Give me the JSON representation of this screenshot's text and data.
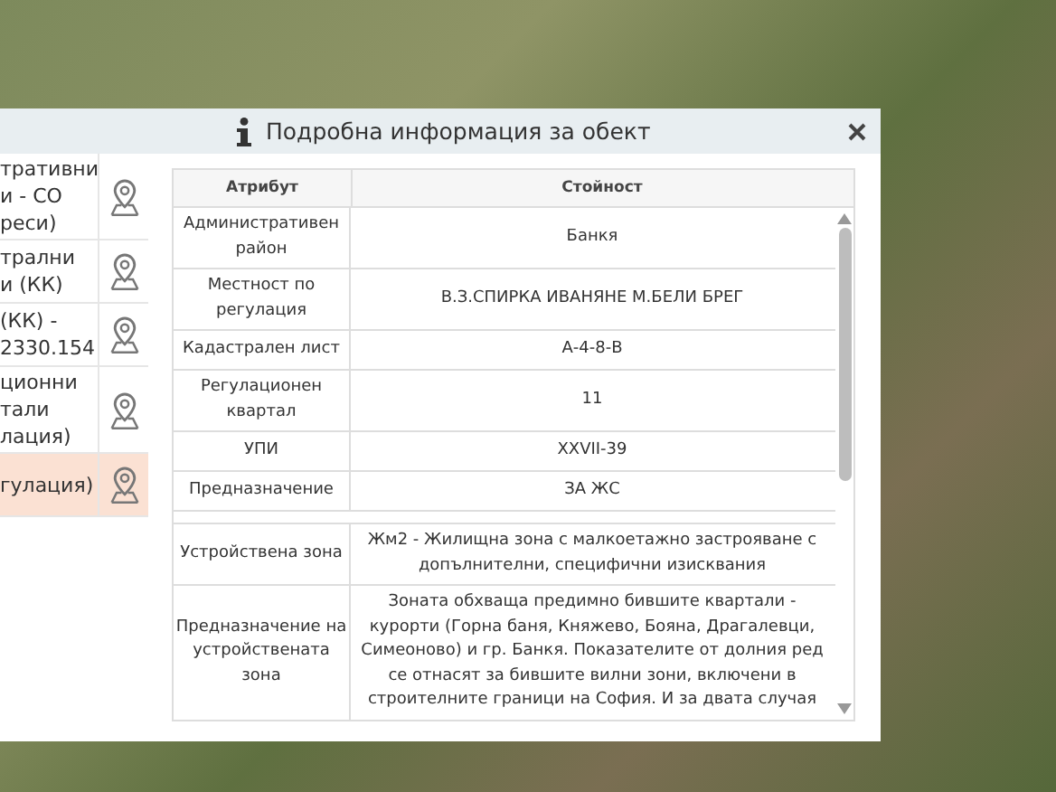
{
  "dialog": {
    "title": "Подробна информация за обект"
  },
  "layers": [
    {
      "lines": [
        "тративни",
        "и - СО",
        "реси)"
      ],
      "selected": false
    },
    {
      "lines": [
        "трални",
        "и (КК)"
      ],
      "selected": false
    },
    {
      "lines": [
        "(КК) -",
        "2330.154"
      ],
      "selected": false
    },
    {
      "lines": [
        "ционни",
        "тали",
        "лация)"
      ],
      "selected": false
    },
    {
      "lines": [
        "гулация)"
      ],
      "selected": true
    }
  ],
  "table": {
    "columns": [
      "Атрибут",
      "Стойност"
    ],
    "rows": [
      {
        "kind": "data",
        "attribute": "Административен район",
        "value": "Банкя"
      },
      {
        "kind": "data",
        "attribute": "Местност по регулация",
        "value": "В.З.СПИРКА ИВАНЯНЕ М.БЕЛИ БРЕГ"
      },
      {
        "kind": "data",
        "attribute": "Кадастрален лист",
        "value": "А-4-8-В"
      },
      {
        "kind": "data",
        "attribute": "Регулационен квартал",
        "value": "11"
      },
      {
        "kind": "data",
        "attribute": "УПИ",
        "value": "XXVII-39"
      },
      {
        "kind": "data",
        "attribute": "Предназначение",
        "value": "ЗА ЖС"
      },
      {
        "kind": "spacer"
      },
      {
        "kind": "data",
        "attribute": "Устройствена зона",
        "value": "Жм2 - Жилищна зона с малкоетажно застрояване с допълнителни, специфични изисквания"
      },
      {
        "kind": "data",
        "attribute": "Предназначение на устройствената зона",
        "value": "Зоната обхваща предимно бившите квартали - курорти (Горна баня, Княжево, Бояна, Драгалевци, Симеоново) и гр. Банкя. Показателите от долния ред се отнасят за бившите вилни зони, включени в строителните граници на София. И за двата случая"
      }
    ]
  }
}
